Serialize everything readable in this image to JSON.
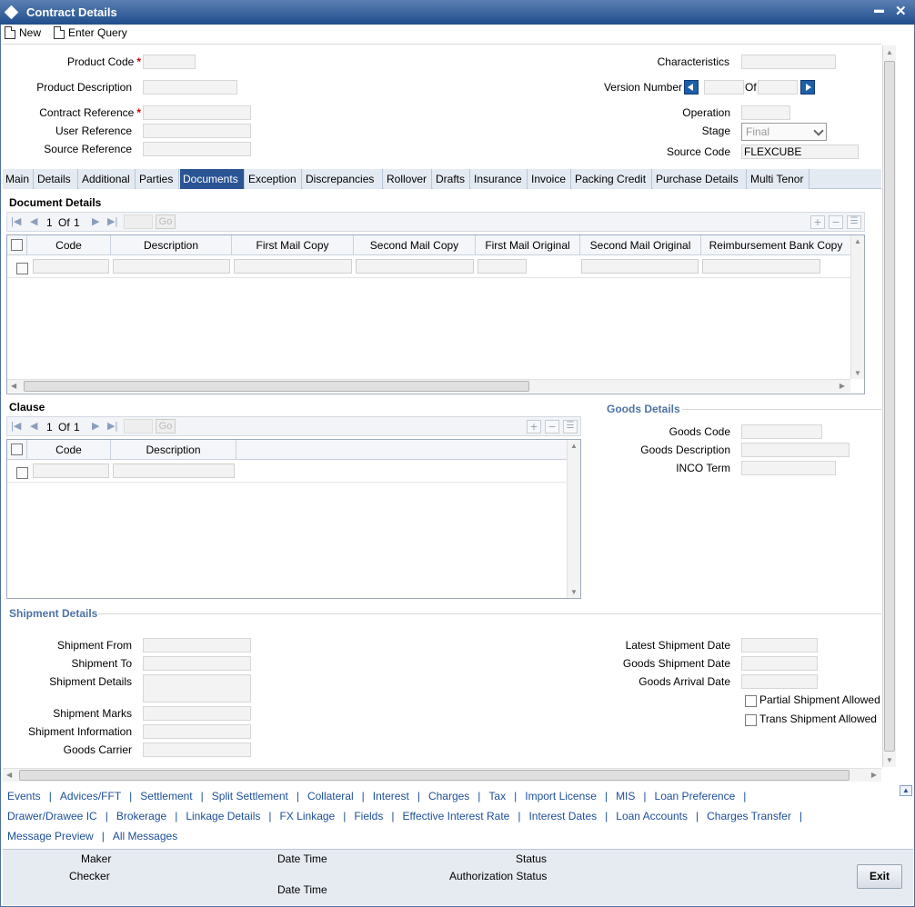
{
  "window": {
    "title": "Contract Details",
    "minimize": "▬",
    "close": "✕"
  },
  "toolbar": {
    "new_label": "New",
    "enter_query_label": "Enter Query"
  },
  "header": {
    "product_code_label": "Product Code",
    "product_description_label": "Product Description",
    "contract_reference_label": "Contract Reference",
    "user_reference_label": "User Reference",
    "source_reference_label": "Source Reference",
    "required_mark": "*",
    "characteristics_label": "Characteristics",
    "version_number_label": "Version Number",
    "of_label": "Of",
    "operation_label": "Operation",
    "stage_label": "Stage",
    "stage_value": "Final",
    "source_code_label": "Source Code",
    "source_code_value": "FLEXCUBE"
  },
  "tabs": [
    "Main",
    "Details",
    "Additional",
    "Parties",
    "Documents",
    "Exception",
    "Discrepancies",
    "Rollover",
    "Drafts",
    "Insurance",
    "Invoice",
    "Packing Credit",
    "Purchase Details",
    "Multi Tenor"
  ],
  "active_tab": "Documents",
  "document_details": {
    "title": "Document Details",
    "pager": {
      "current": "1",
      "of_label": "Of",
      "total": "1",
      "go": "Go"
    },
    "columns": [
      "Code",
      "Description",
      "First Mail Copy",
      "Second Mail Copy",
      "First Mail Original",
      "Second Mail Original",
      "Reimbursement Bank Copy"
    ]
  },
  "clause": {
    "title": "Clause",
    "pager": {
      "current": "1",
      "of_label": "Of",
      "total": "1",
      "go": "Go"
    },
    "columns": [
      "Code",
      "Description"
    ]
  },
  "goods_details": {
    "title": "Goods Details",
    "goods_code_label": "Goods Code",
    "goods_description_label": "Goods Description",
    "inco_term_label": "INCO Term"
  },
  "shipment_details": {
    "title": "Shipment Details",
    "shipment_from_label": "Shipment From",
    "shipment_to_label": "Shipment To",
    "shipment_details_label": "Shipment Details",
    "shipment_marks_label": "Shipment Marks",
    "shipment_information_label": "Shipment Information",
    "goods_carrier_label": "Goods Carrier",
    "latest_shipment_date_label": "Latest Shipment Date",
    "goods_shipment_date_label": "Goods Shipment Date",
    "goods_arrival_date_label": "Goods Arrival Date",
    "partial_shipment_label": "Partial Shipment Allowed",
    "trans_shipment_label": "Trans Shipment Allowed"
  },
  "links_row1": [
    "Events",
    "Advices/FFT",
    "Settlement",
    "Split Settlement",
    "Collateral",
    "Interest",
    "Charges",
    "Tax",
    "Import License",
    "MIS",
    "Loan Preference"
  ],
  "links_row2": [
    "Drawer/Drawee IC",
    "Brokerage",
    "Linkage Details",
    "FX Linkage",
    "Fields",
    "Effective Interest Rate",
    "Interest Dates",
    "Loan Accounts",
    "Charges Transfer"
  ],
  "links_row3": [
    "Message Preview",
    "All Messages"
  ],
  "footer": {
    "maker_label": "Maker",
    "checker_label": "Checker",
    "date_time_label": "Date Time",
    "status_label": "Status",
    "authorization_status_label": "Authorization Status",
    "exit_label": "Exit"
  },
  "colors": {
    "titlebar": "#1f4e8c",
    "active_tab": "#2a5494",
    "link": "#1d4f99",
    "section_title": "#4f73a6",
    "required": "#cc0000"
  }
}
